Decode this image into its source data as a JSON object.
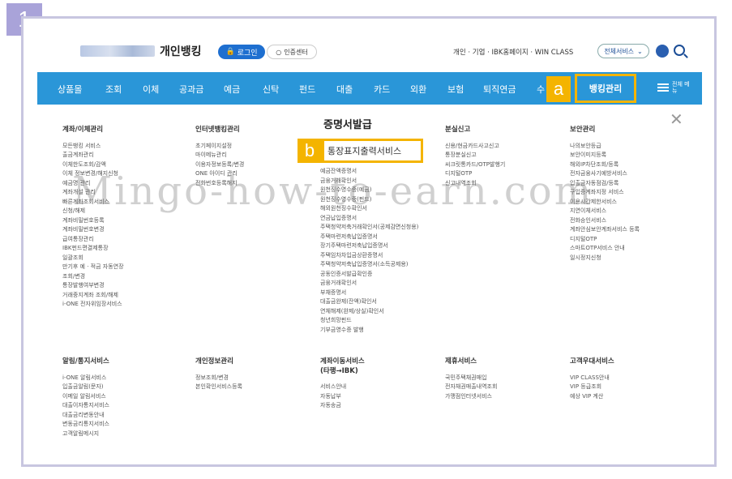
{
  "badge": "1",
  "header": {
    "brand": "개인뱅킹",
    "login": "로그인",
    "cert_center": "인증센터",
    "top_links": "개인 · 기업 · IBK홈페이지 · WIN CLASS",
    "all_services": "전체서비스",
    "all_services_chevron": "⌄"
  },
  "nav": {
    "items": [
      "상품몰",
      "조회",
      "이체",
      "공과금",
      "예금",
      "신탁",
      "펀드",
      "대출",
      "카드",
      "외환",
      "보험",
      "퇴직연금",
      "수"
    ],
    "banking_mgmt": "뱅킹관리",
    "all_menu": "전체 메뉴"
  },
  "labels": {
    "a": "a",
    "b": "b"
  },
  "columns": {
    "transfer": {
      "title": "계좌/이체관리",
      "items": [
        "모든뱅킹 서비스",
        "출금계좌관리",
        "이체한도조회/감액",
        "이체 정보변경/해지신청",
        "예금명 관리",
        "계좌개설 관리",
        "빠른계좌조회서비스",
        "신청/해제",
        "계좌비밀번호등록",
        "계좌비밀번호변경",
        "급여통장관리",
        "IBK펀드편결제통장",
        "일괄조회",
        "만기후 예 · 적금 자동연장",
        "조회/변경",
        "통장발행여부변경",
        "거래중지계좌 조회/해제",
        "i-ONE 전자위임장서비스"
      ]
    },
    "internet": {
      "title": "인터넷뱅킹관리",
      "items": [
        "초기페이지설정",
        "마이메뉴관리",
        "이용자정보등록/변경",
        "ONE 아이디 관리",
        "전화번호등록해지"
      ]
    },
    "cert": {
      "title": "증명서발급",
      "highlight": "통장표지출력서비스",
      "items": [
        "예금잔액증명서",
        "금융거래확인서",
        "원천징수영수증(예금)",
        "원천징수영수증(펀드)",
        "해외원천징수확인서",
        "연금납입증명서",
        "주택청약저축거래확인서(공제감면신청용)",
        "주택마련저축납입증명서",
        "장기주택마련저축납입증명서",
        "주택임차차입금상환증명서",
        "주택청약저축납입증명서(소득공제용)",
        "공동인증서발급확인증",
        "금융거래확인서",
        "부채증명서",
        "대출금완제(잔액)확인서",
        "연체해제(완제/상실)확인서",
        "청년희망펀드",
        "기부금영수증 발행"
      ]
    },
    "loss": {
      "title": "분실신고",
      "items": [
        "신용/현금카드사고신고",
        "통장분실신고",
        "씨크릿통카드/OTP발행기",
        "디지털OTP",
        "신고내역조회"
      ]
    },
    "security": {
      "title": "보안관리",
      "items": [
        "나의보안등급",
        "보안이미지등록",
        "해외IP차단조회/등록",
        "전자금융사기예방서비스",
        "입출금자동점검/등록",
        "구입증계좌지정 서비스",
        "이용시간제한서비스",
        "지연이체서비스",
        "전화승인서비스",
        "계좌안심보안계좌서비스 등록",
        "디지털OTP",
        "스마트OTP서비스 안내",
        "일시정지신청"
      ]
    },
    "alert": {
      "title": "알림/통지서비스",
      "items": [
        "i-ONE 알림서비스",
        "입출금알림(문자)",
        "이메일 알림서비스",
        "대출이자통지서비스",
        "대출금리변동안내",
        "변동금리통지서비스",
        "고객알림메시지"
      ]
    },
    "privacy": {
      "title": "개인정보관리",
      "items": [
        "정보조회/변경",
        "본인확인서비스등록"
      ]
    },
    "account_move": {
      "title": "계좌이동서비스",
      "title2": "(타행→IBK)",
      "items": [
        "서비스안내",
        "자동납부",
        "자동송금"
      ]
    },
    "partner": {
      "title": "제휴서비스",
      "items": [
        "국민주택채권매입",
        "전자채권매출내역조회",
        "가맹점인터넷서비스"
      ]
    },
    "vip": {
      "title": "고객우대서비스",
      "items": [
        "VIP CLASS안내",
        "VIP 등급조회",
        "예상 VIP 계산"
      ]
    }
  },
  "watermark": "Mingo-how-to-earn.com"
}
